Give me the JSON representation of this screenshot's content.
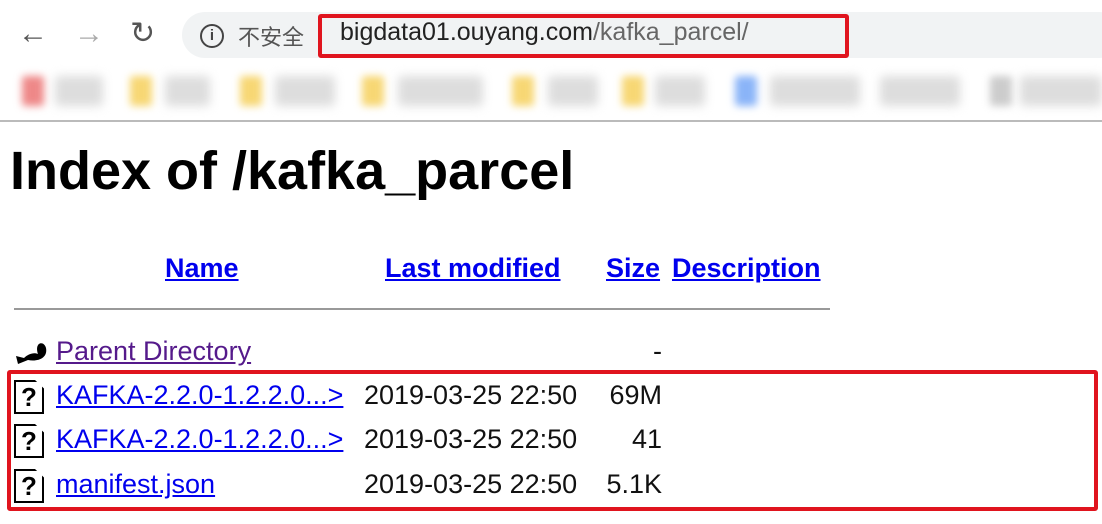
{
  "browser": {
    "back_icon": "arrow-left-icon",
    "forward_icon": "arrow-right-icon",
    "reload_icon": "reload-icon",
    "security_label": "不安全",
    "url_host": "bigdata01.ouyang.com",
    "url_path": "/kafka_parcel/"
  },
  "page": {
    "title": "Index of /kafka_parcel",
    "columns": [
      "Name",
      "Last modified",
      "Size",
      "Description"
    ],
    "parent": {
      "name": "Parent Directory",
      "size": "-"
    },
    "files": [
      {
        "name": "KAFKA-2.2.0-1.2.2.0...>",
        "modified": "2019-03-25 22:50",
        "size": "69M"
      },
      {
        "name": "KAFKA-2.2.0-1.2.2.0...>",
        "modified": "2019-03-25 22:50",
        "size": "41"
      },
      {
        "name": "manifest.json",
        "modified": "2019-03-25 22:50",
        "size": "5.1K"
      }
    ]
  },
  "colors": {
    "highlight": "#e0141e",
    "link": "#0000ee",
    "visited": "#551a8b"
  }
}
